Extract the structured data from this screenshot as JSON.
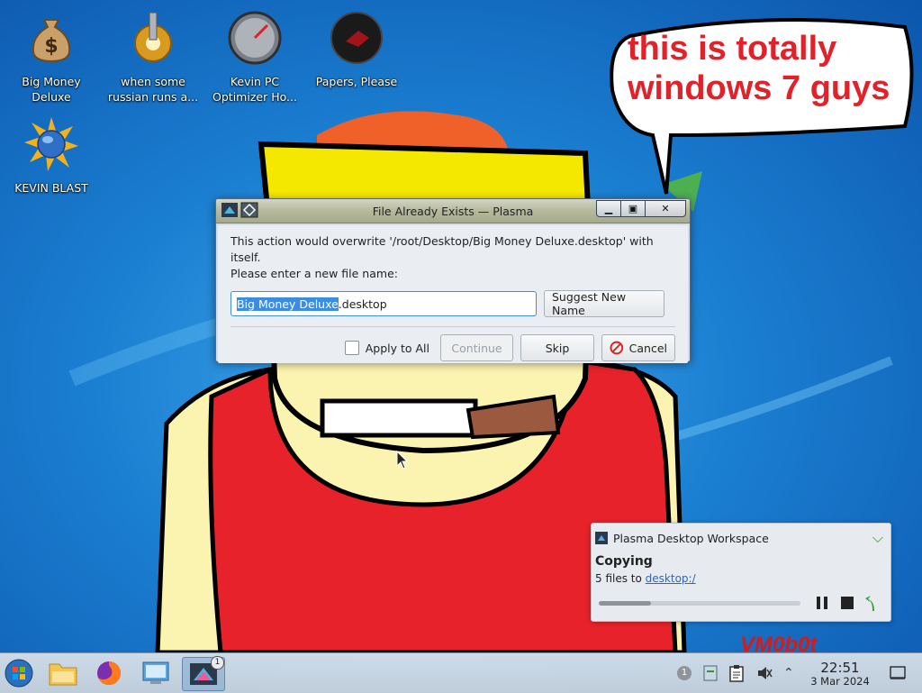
{
  "desktop": {
    "icons": [
      {
        "label": "Big Money\nDeluxe",
        "icon": "money-bag-icon"
      },
      {
        "label": "when some\nrussian runs a...",
        "icon": "gear-icon"
      },
      {
        "label": "Kevin PC\nOptimizer Ho...",
        "icon": "gauge-icon"
      },
      {
        "label": "Papers, Please",
        "icon": "papers-please-icon"
      },
      {
        "label": "KEVIN BLAST",
        "icon": "globe-sun-icon"
      }
    ],
    "bubble_text": "this is totally windows 7 guys",
    "signature": "VM0b0t"
  },
  "dialog": {
    "title": "File Already Exists — Plasma",
    "message_line1": "This action would overwrite '/root/Desktop/Big Money Deluxe.desktop' with itself.",
    "message_line2": "Please enter a new file name:",
    "filename_selected": "Big Money Deluxe",
    "filename_rest": ".desktop",
    "suggest_label": "Suggest New Name",
    "apply_all_label": "Apply to All",
    "continue_label": "Continue",
    "skip_label": "Skip",
    "cancel_label": "Cancel",
    "window_buttons": {
      "close": "✕"
    }
  },
  "notification": {
    "app": "Plasma Desktop Workspace",
    "title": "Copying",
    "sub_prefix": "5 files to ",
    "sub_link": "desktop:/",
    "progress": 0.26
  },
  "taskbar": {
    "items": [
      "start-orb-icon",
      "file-manager-icon",
      "firefox-icon",
      "system-settings-icon",
      "plasma-dialog-task-icon"
    ],
    "active_badge": "1",
    "tray_badge": "1",
    "clock_time": "22:51",
    "clock_date": "3 Mar 2024"
  },
  "colors": {
    "bubble_text": "#e0232b",
    "accent": "#3a8de0",
    "notif_link": "#2a66c8"
  }
}
